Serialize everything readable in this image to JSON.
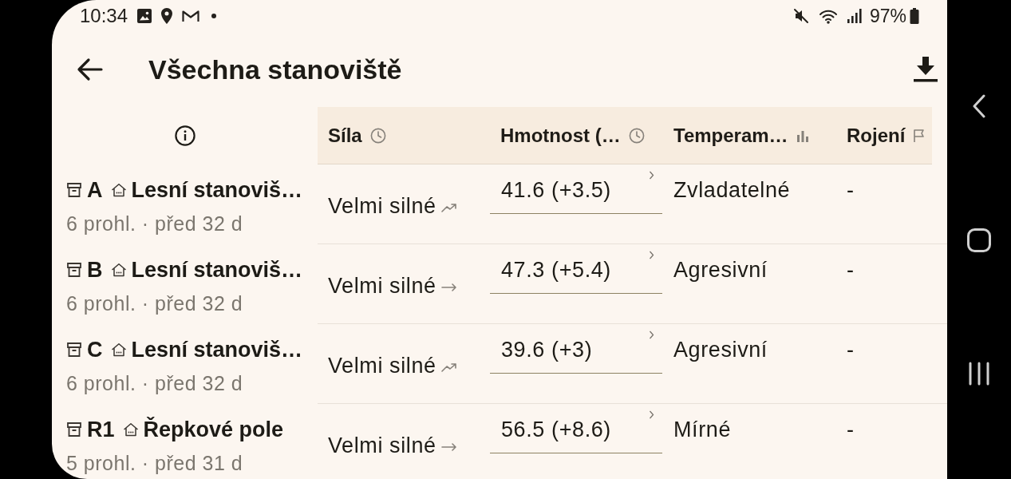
{
  "status_bar": {
    "time": "10:34",
    "battery": "97%"
  },
  "app_bar": {
    "title": "Všechna stanoviště"
  },
  "table": {
    "columns": [
      {
        "label": "Síla"
      },
      {
        "label": "Hmotnost (…"
      },
      {
        "label": "Temperam…"
      },
      {
        "label": "Rojení"
      }
    ],
    "rows": [
      {
        "code": "A",
        "name": "Lesní stanoviš…",
        "meta": "6 prohl. · před 32 d",
        "strength": "Velmi silné",
        "rising": true,
        "weight": "41.6 (+3.5)",
        "temperament": "Zvladatelné",
        "swarming": "-"
      },
      {
        "code": "B",
        "name": "Lesní stanoviš…",
        "meta": "6 prohl. · před 32 d",
        "strength": "Velmi silné",
        "rising": false,
        "weight": "47.3 (+5.4)",
        "temperament": "Agresivní",
        "swarming": "-"
      },
      {
        "code": "C",
        "name": "Lesní stanoviš…",
        "meta": "6 prohl. · před 32 d",
        "strength": "Velmi silné",
        "rising": true,
        "weight": "39.6 (+3)",
        "temperament": "Agresivní",
        "swarming": "-"
      },
      {
        "code": "R1",
        "name": "Řepkové pole",
        "meta": "5 prohl. · před 31 d",
        "strength": "Velmi silné",
        "rising": false,
        "weight": "56.5 (+8.6)",
        "temperament": "Mírné",
        "swarming": "-"
      }
    ]
  }
}
